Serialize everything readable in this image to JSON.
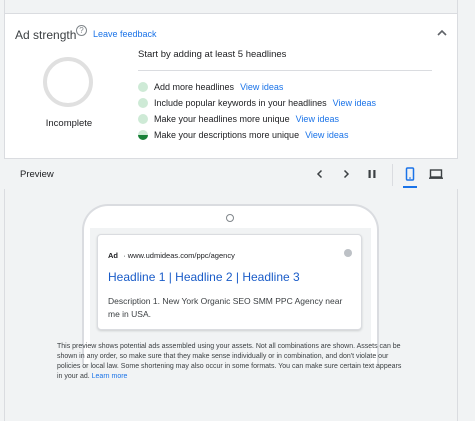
{
  "ad_strength": {
    "title": "Ad strength",
    "help_icon": "help-circle-icon",
    "feedback_link": "Leave feedback",
    "status": "Incomplete",
    "start_text": "Start by adding at least 5 headlines",
    "tips": [
      {
        "text": "Add more headlines",
        "link": "View ideas"
      },
      {
        "text": "Include popular keywords in your headlines",
        "link": "View ideas"
      },
      {
        "text": "Make your headlines more unique",
        "link": "View ideas"
      },
      {
        "text": "Make your descriptions more unique",
        "link": "View ideas"
      }
    ]
  },
  "preview": {
    "title": "Preview",
    "controls": [
      "chevron-left-icon",
      "chevron-right-icon",
      "pause-icon",
      "mobile-icon",
      "desktop-icon"
    ],
    "active_device": "mobile"
  },
  "ad": {
    "badge": "Ad",
    "separator": "·",
    "url": "www.udmideas.com/ppc/agency",
    "headline": "Headline 1 | Headline 2 | Headline 3",
    "description": "Description 1. New York Organic SEO SMM PPC Agency near me in USA."
  },
  "disclaimer": {
    "text": "This preview shows potential ads assembled using your assets. Not all combinations are shown. Assets can be shown in any order, so make sure that they make sense individually or in combination, and don't violate our policies or local law. Some shortening may also occur in some formats. You can make sure certain text appears in your ad.",
    "link": "Learn more"
  },
  "colors": {
    "link": "#1a73e8",
    "headline": "#1a5cc8",
    "tip_dot": "#ceead6",
    "tip_dot_done": "#188038"
  }
}
